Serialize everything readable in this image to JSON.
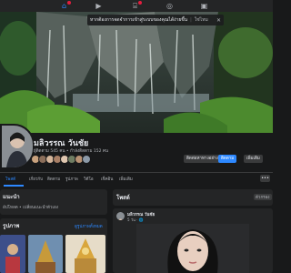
{
  "nav": {
    "icons": [
      "home-icon",
      "watch-icon",
      "marketplace-icon",
      "groups-icon",
      "gaming-icon"
    ],
    "icon_glyphs": [
      "⌂",
      "▶",
      "⌸",
      "◎",
      "▣"
    ]
  },
  "banner": {
    "text": "หากต้องการจดจำการเข้าสู่ระบบของคุณได้ง่ายขึ้น",
    "link": "ใช่ไหม",
    "close": "✕"
  },
  "profile": {
    "name": "มลิวรรณ วันชัย",
    "stats": "ผู้ติดตาม 545 คน • กำลังติดตาม 152 คน"
  },
  "actions": {
    "message": "ติดต่อหาทางอย่าง",
    "follow": "ติดตาม",
    "more": "เพิ่มเติม"
  },
  "tabs": [
    "โพสต์",
    "เกี่ยวกับ",
    "ติดตาม",
    "รูปภาพ",
    "วิดีโอ",
    "เช็คอิน",
    "เพิ่มเติม"
  ],
  "tab_more": "•••",
  "intro": {
    "title": "แนะนำ",
    "text": "อัปโหลด • เปลี่ยนแนะนำตัวเอง"
  },
  "photos": {
    "title": "รูปภาพ",
    "link": "ดูรูปภาพทั้งหมด"
  },
  "posts": {
    "title": "โพสต์",
    "filter": "ตัวกรอง",
    "author": "มลิวรรณ วันชัย",
    "time": "5 วัน · 🌐"
  },
  "colors": {
    "accent": "#2d88ff",
    "background": "#18191a",
    "surface": "#242526"
  }
}
